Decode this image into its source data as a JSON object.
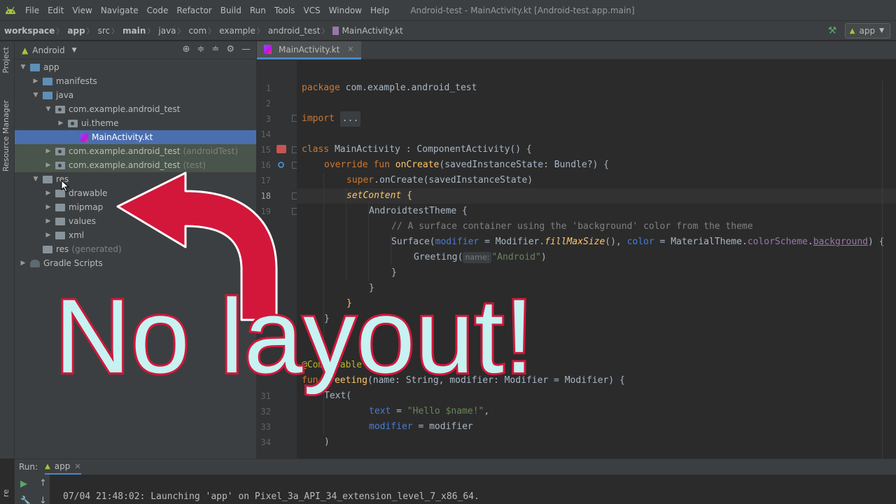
{
  "menubar": {
    "items": [
      "File",
      "Edit",
      "View",
      "Navigate",
      "Code",
      "Refactor",
      "Build",
      "Run",
      "Tools",
      "VCS",
      "Window",
      "Help"
    ],
    "window_title": "Android-test - MainActivity.kt [Android-test.app.main]"
  },
  "breadcrumb": [
    "workspace",
    "app",
    "src",
    "main",
    "java",
    "com",
    "example",
    "android_test",
    "MainActivity.kt"
  ],
  "run_config": "app",
  "side_strip": {
    "project": "Project",
    "resource_manager": "Resource Manager",
    "bottom": "re"
  },
  "project_panel": {
    "view": "Android",
    "tree": [
      {
        "label": "app",
        "suffix": ""
      },
      {
        "label": "manifests",
        "suffix": ""
      },
      {
        "label": "java",
        "suffix": ""
      },
      {
        "label": "com.example.android_test",
        "suffix": ""
      },
      {
        "label": "ui.theme",
        "suffix": ""
      },
      {
        "label": "MainActivity.kt",
        "suffix": ""
      },
      {
        "label": "com.example.android_test",
        "suffix": "(androidTest)"
      },
      {
        "label": "com.example.android_test",
        "suffix": "(test)"
      },
      {
        "label": "res",
        "suffix": ""
      },
      {
        "label": "drawable",
        "suffix": ""
      },
      {
        "label": "mipmap",
        "suffix": ""
      },
      {
        "label": "values",
        "suffix": ""
      },
      {
        "label": "xml",
        "suffix": ""
      },
      {
        "label": "res",
        "suffix": "(generated)"
      },
      {
        "label": "Gradle Scripts",
        "suffix": ""
      }
    ]
  },
  "editor": {
    "tab": "MainActivity.kt",
    "line_numbers": [
      "1",
      "2",
      "3",
      "14",
      "15",
      "16",
      "17",
      "18",
      "19",
      "",
      "",
      "",
      "",
      "",
      "",
      "",
      "",
      "",
      "",
      "30",
      "31",
      "32",
      "33",
      "34"
    ],
    "code": {
      "l1_kw": "package",
      "l1_rest": " com.example.android_test",
      "l3_kw": "import",
      "l3_fold": "...",
      "l15_kw": "class",
      "l15_rest": " MainActivity : ComponentActivity() {",
      "l16_kw": "override fun",
      "l16_fn": "onCreate",
      "l16_rest": "(savedInstanceState: Bundle?) {",
      "l17_kw": "super",
      "l17_rest": ".onCreate(savedInstanceState)",
      "l18_fn": "setContent",
      "l18_rest": " {",
      "l19": "AndroidtestTheme {",
      "l20": "// A surface container using the 'background' color from the theme",
      "l21_a": "Surface(",
      "l21_b": "modifier",
      "l21_c": " = Modifier.",
      "l21_d": "fillMaxSize",
      "l21_e": "(), ",
      "l21_f": "color",
      "l21_g": " = MaterialTheme.",
      "l21_h": "colorScheme",
      "l21_i": ".",
      "l21_j": "background",
      "l21_k": ") {",
      "l22_a": "Greeting(",
      "l22_hint": "name:",
      "l22_str": "\"Android\"",
      "l22_b": ")",
      "l23": "}",
      "l24": "}",
      "l25": "}",
      "l26": "}",
      "l29_kw": "@Composable",
      "l30_kw": "fun",
      "l30_fn": "Greeting",
      "l30_rest": "(name: String, modifier: Modifier = Modifier) {",
      "l31": "Text(",
      "l32_a": "text",
      "l32_b": " = ",
      "l32_str": "\"Hello $name!\"",
      "l32_c": ",",
      "l33_a": "modifier",
      "l33_b": " = modifier",
      "l34": ")"
    }
  },
  "run_panel": {
    "label": "Run:",
    "tab": "app",
    "output": "07/04 21:48:02: Launching 'app' on Pixel_3a_API_34_extension_level_7_x86_64."
  },
  "overlay": {
    "text": "No layout!"
  },
  "colors": {
    "accent": "#4a88c7",
    "overlay_fill": "#c7f2f2",
    "overlay_stroke": "#d3173b"
  }
}
